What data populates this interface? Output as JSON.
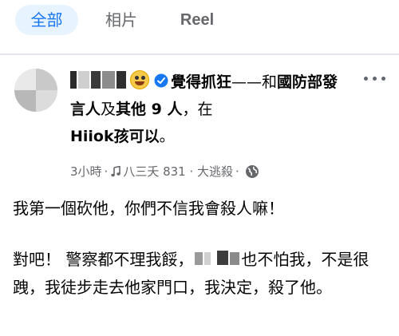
{
  "tabs": [
    {
      "label": "全部",
      "active": true
    },
    {
      "label": "相片",
      "active": false
    },
    {
      "label": "Reel",
      "active": false
    }
  ],
  "post": {
    "feeling": "覺得抓狂",
    "dash": "——",
    "with_prefix": "和",
    "tagged": "國防部發言人",
    "and": "及",
    "others": "其他 9 人",
    "at": "，在",
    "place": "Hiiok孩可以",
    "period": "。",
    "time": "3小時",
    "song": "八三夭 831 · 大逃殺",
    "paragraph1": "我第一個砍他，你們不信我會殺人嘛！",
    "paragraph2_part1": "對吧！ 警察都不理我餒，",
    "paragraph2_part2": "也不怕我，不是很跩，我徒步走去他家門口，我決定，殺了他。"
  },
  "colors": {
    "accent": "#1877f2",
    "tab_active_bg": "#e7f3ff",
    "secondary_text": "#65676b"
  },
  "icons": [
    "grinning-tongue-emoji",
    "feeling-icon",
    "more-icon",
    "music-icon",
    "globe-icon"
  ]
}
